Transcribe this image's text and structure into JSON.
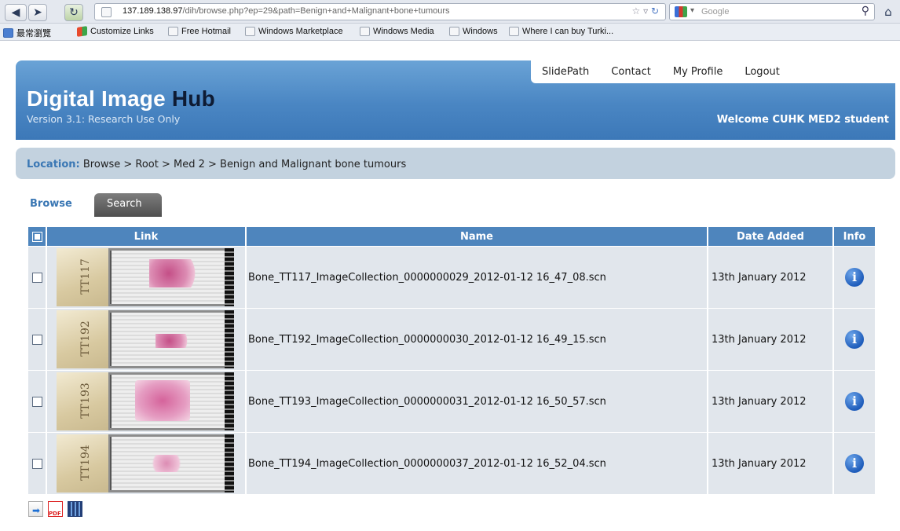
{
  "browser": {
    "back_icon": "back-arrow-icon",
    "forward_icon": "forward-arrow-icon",
    "url_host": "137.189.138.97",
    "url_path": "/dih/browse.php?ep=29&path=Benign+and+Malignant+bone+tumours",
    "search_placeholder": "Google",
    "bookmarks": [
      {
        "label": "最常瀏覽",
        "icon": "blue"
      },
      {
        "label": "Customize Links",
        "icon": "win"
      },
      {
        "label": "Free Hotmail",
        "icon": "page"
      },
      {
        "label": "Windows Marketplace",
        "icon": "page"
      },
      {
        "label": "Windows Media",
        "icon": "page"
      },
      {
        "label": "Windows",
        "icon": "page"
      },
      {
        "label": "Where I can buy Turki...",
        "icon": "page"
      }
    ]
  },
  "header": {
    "title_main": "Digital Image ",
    "title_accent": "Hub",
    "version": "Version 3.1: Research Use Only",
    "welcome": "Welcome CUHK MED2 student",
    "nav": [
      "SlidePath",
      "Contact",
      "My Profile",
      "Logout"
    ]
  },
  "location": {
    "label": "Location:",
    "path": "Browse > Root > Med 2 > Benign and Malignant bone tumours"
  },
  "tabs": {
    "browse": "Browse",
    "search": "Search"
  },
  "table": {
    "columns": {
      "link": "Link",
      "name": "Name",
      "date": "Date Added",
      "info": "Info"
    },
    "rows": [
      {
        "label_text": "TT117",
        "name": "Bone_TT117_ImageCollection_0000000029_2012-01-12 16_47_08.scn",
        "date": "13th January 2012"
      },
      {
        "label_text": "TT192",
        "name": "Bone_TT192_ImageCollection_0000000030_2012-01-12 16_49_15.scn",
        "date": "13th January 2012"
      },
      {
        "label_text": "TT193",
        "name": "Bone_TT193_ImageCollection_0000000031_2012-01-12 16_50_57.scn",
        "date": "13th January 2012"
      },
      {
        "label_text": "TT194",
        "name": "Bone_TT194_ImageCollection_0000000037_2012-01-12 16_52_04.scn",
        "date": "13th January 2012"
      }
    ]
  },
  "exports": [
    "csv-export-icon",
    "pdf-export-icon",
    "video-export-icon"
  ],
  "colors": {
    "header_blue": "#4a86c3",
    "table_header": "#4e85bd",
    "row_bg": "#e1e6ec",
    "location_bg": "#c3d2df"
  }
}
